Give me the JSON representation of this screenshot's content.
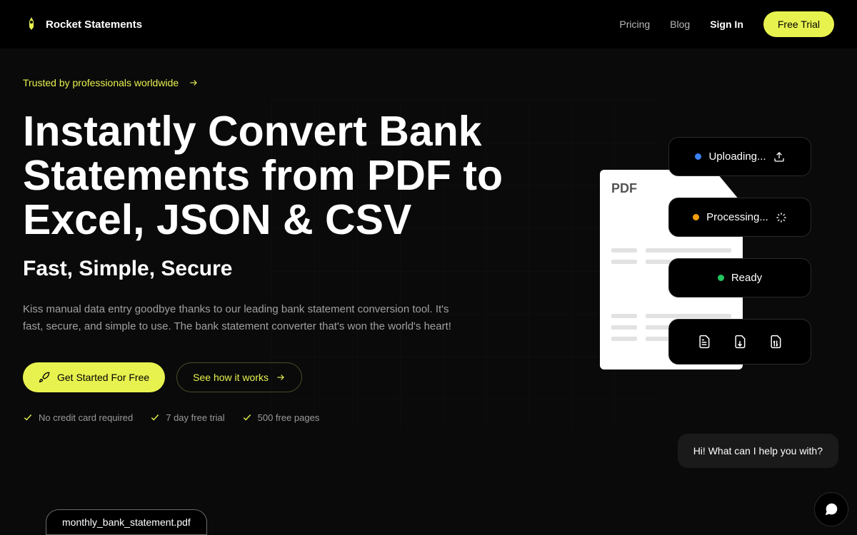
{
  "header": {
    "brand": "Rocket Statements",
    "nav": {
      "pricing": "Pricing",
      "blog": "Blog",
      "signin": "Sign In",
      "free_trial": "Free Trial"
    }
  },
  "hero": {
    "trusted": "Trusted by professionals worldwide",
    "headline": "Instantly Convert Bank Statements from PDF to Excel, JSON & CSV",
    "subheadline": "Fast, Simple, Secure",
    "description": "Kiss manual data entry goodbye thanks to our leading bank statement conversion tool. It's fast, secure, and simple to use. The bank statement converter that's won the world's heart!",
    "cta_primary": "Get Started For Free",
    "cta_secondary": "See how it works",
    "features": [
      "No credit card required",
      "7 day free trial",
      "500 free pages"
    ]
  },
  "preview": {
    "pdf_label": "PDF",
    "status": {
      "uploading": "Uploading...",
      "processing": "Processing...",
      "ready": "Ready"
    },
    "file_name": "monthly_bank_statement.pdf"
  },
  "chat": {
    "greeting": "Hi! What can I help you with?"
  }
}
